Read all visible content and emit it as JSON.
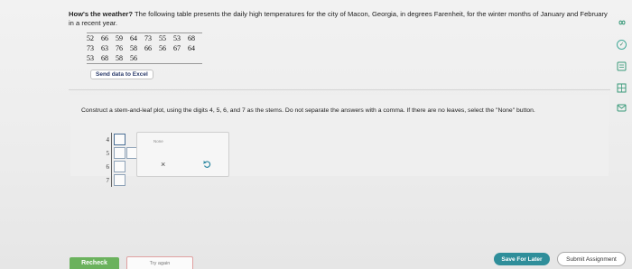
{
  "prompt": {
    "lead": "How's the weather?",
    "text": " The following table presents the daily high temperatures for the city of Macon, Georgia, in degrees Farenheit, for the winter months of January and February in a recent year."
  },
  "table": {
    "rows": [
      [
        "52",
        "66",
        "59",
        "64",
        "73",
        "55",
        "53",
        "68"
      ],
      [
        "73",
        "63",
        "76",
        "58",
        "66",
        "56",
        "67",
        "64"
      ],
      [
        "53",
        "68",
        "58",
        "56",
        "",
        "",
        "",
        ""
      ]
    ]
  },
  "excel_button": {
    "label": "Send data to Excel"
  },
  "question": {
    "text": "Construct a stem-and-leaf plot, using the digits 4, 5, 6, and 7 as the stems. Do not separate the answers with a comma. If there are no leaves, select the \"None\" button."
  },
  "stems": [
    {
      "stem": "4",
      "boxes": 1
    },
    {
      "stem": "5",
      "boxes": 2
    },
    {
      "stem": "6",
      "boxes": 1
    },
    {
      "stem": "7",
      "boxes": 1
    }
  ],
  "keypad": {
    "none_label": "None",
    "clear_label": "×"
  },
  "footer": {
    "recheck_label": "Recheck",
    "try_again_label": "Try again",
    "save_later_label": "Save For Later",
    "submit_label": "Submit Assignment"
  },
  "sidebar_icons": [
    "infinity-icon",
    "check-icon",
    "calculator-icon",
    "grid-icon",
    "mail-icon"
  ],
  "colors": {
    "recheck": "#6bb25d",
    "save_later": "#2f8e9a",
    "leaf_border": "#8fa3b8",
    "icon_green": "#44aa99"
  }
}
